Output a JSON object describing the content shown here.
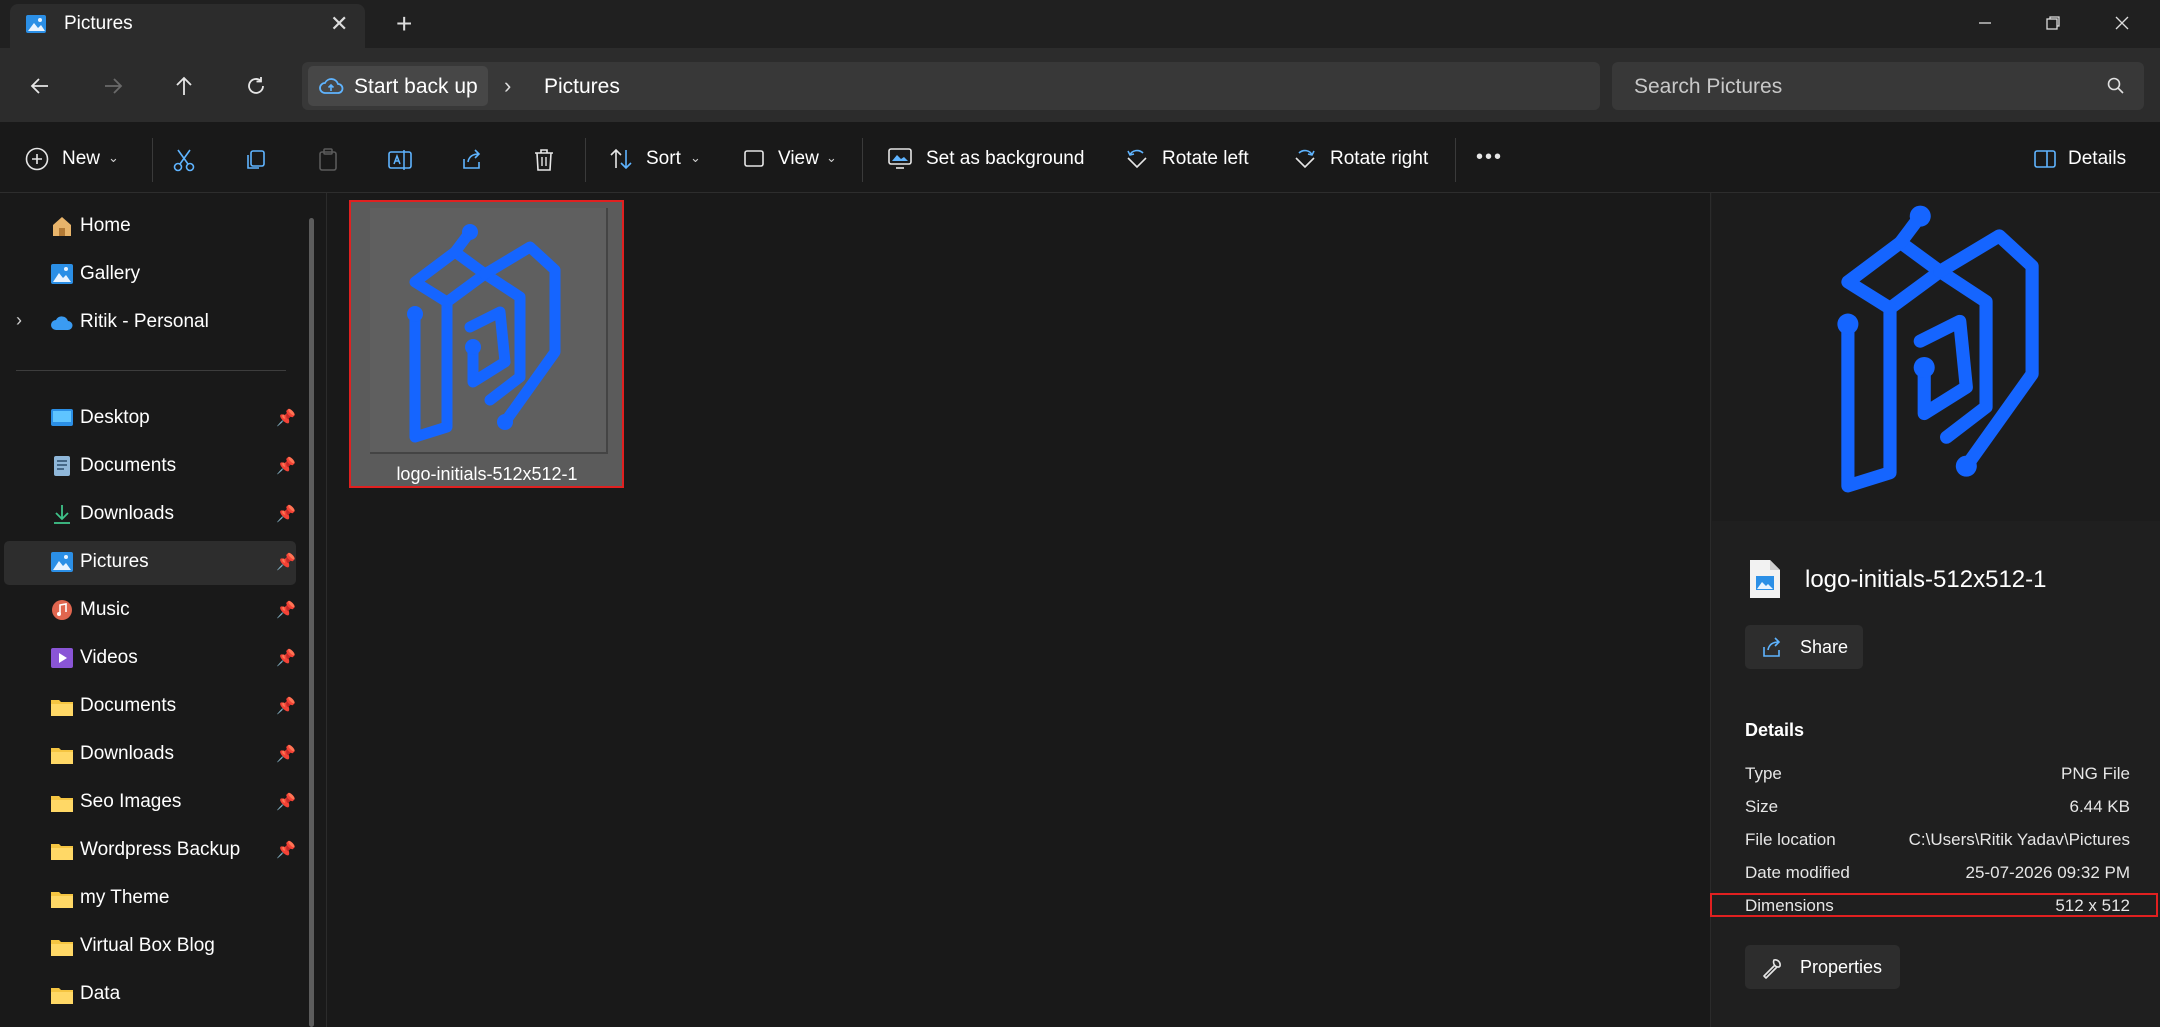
{
  "window": {
    "tab_title": "Pictures",
    "close_tab": "✕",
    "new_tab": "+"
  },
  "address": {
    "breadcrumb_root": "Start back up",
    "breadcrumb_sep": "›",
    "breadcrumb_current": "Pictures",
    "search_placeholder": "Search Pictures"
  },
  "toolbar": {
    "new_label": "New",
    "sort_label": "Sort",
    "view_label": "View",
    "set_bg_label": "Set as background",
    "rotate_left_label": "Rotate left",
    "rotate_right_label": "Rotate right",
    "more_label": "•••",
    "details_label": "Details"
  },
  "sidebar": {
    "top_items": [
      {
        "label": "Home",
        "icon": "home-icon"
      },
      {
        "label": "Gallery",
        "icon": "gallery-icon"
      },
      {
        "label": "Ritik - Personal",
        "icon": "onedrive-cloud-icon"
      }
    ],
    "pinned_items": [
      {
        "label": "Desktop",
        "icon": "desktop-icon",
        "pinned": true
      },
      {
        "label": "Documents",
        "icon": "documents-icon",
        "pinned": true
      },
      {
        "label": "Downloads",
        "icon": "downloads-icon",
        "pinned": true
      },
      {
        "label": "Pictures",
        "icon": "pictures-icon",
        "pinned": true,
        "selected": true
      },
      {
        "label": "Music",
        "icon": "music-icon",
        "pinned": true
      },
      {
        "label": "Videos",
        "icon": "videos-icon",
        "pinned": true
      },
      {
        "label": "Documents",
        "icon": "folder-icon",
        "pinned": true
      },
      {
        "label": "Downloads",
        "icon": "folder-icon",
        "pinned": true
      },
      {
        "label": "Seo Images",
        "icon": "folder-icon",
        "pinned": true
      },
      {
        "label": "Wordpress Backup",
        "icon": "folder-icon",
        "pinned": true
      },
      {
        "label": "my Theme",
        "icon": "folder-icon",
        "pinned": false
      },
      {
        "label": "Virtual Box Blog",
        "icon": "folder-icon",
        "pinned": false
      },
      {
        "label": "Data",
        "icon": "folder-icon",
        "pinned": false
      }
    ]
  },
  "content": {
    "files": [
      {
        "name": "logo-initials-512x512-1",
        "selected": true
      }
    ]
  },
  "details_pane": {
    "file_name": "logo-initials-512x512-1",
    "share_label": "Share",
    "heading": "Details",
    "properties": [
      {
        "key": "Type",
        "value": "PNG File"
      },
      {
        "key": "Size",
        "value": "6.44 KB"
      },
      {
        "key": "File location",
        "value": "C:\\Users\\Ritik Yadav\\Pictures"
      },
      {
        "key": "Date modified",
        "value": "25-07-2026 09:32 PM"
      },
      {
        "key": "Dimensions",
        "value": "512 x 512"
      }
    ],
    "properties_label": "Properties"
  },
  "colors": {
    "accent": "#1565ff",
    "selection_outline": "#e02020",
    "folder": "#f5c542"
  }
}
